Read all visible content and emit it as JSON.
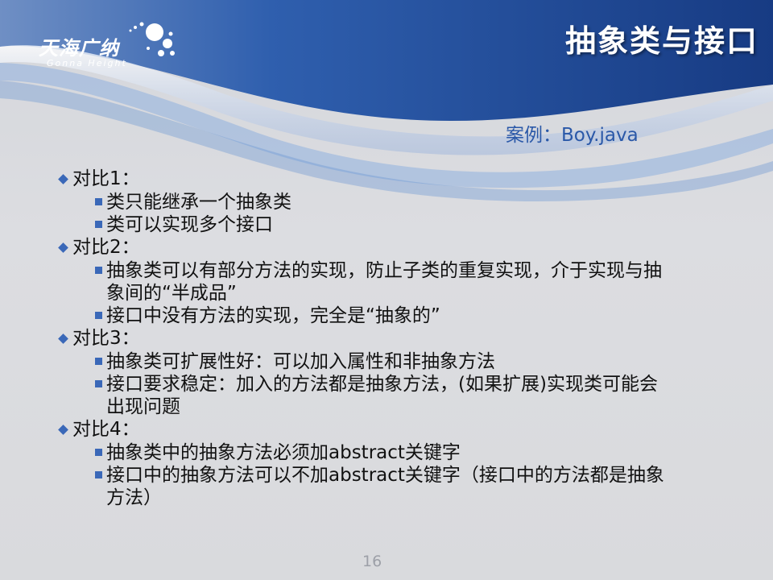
{
  "logo": {
    "name_cn": "天海广纳",
    "name_en": "Gonna Height"
  },
  "title": "抽象类与接口",
  "example": "案例：Boy.java",
  "sections": [
    {
      "heading": "对比1：",
      "items": [
        "类只能继承一个抽象类",
        "类可以实现多个接口"
      ]
    },
    {
      "heading": "对比2：",
      "items": [
        "抽象类可以有部分方法的实现，防止子类的重复实现，介于实现与抽象间的“半成品”",
        "接口中没有方法的实现，完全是“抽象的”"
      ]
    },
    {
      "heading": "对比3：",
      "items": [
        "抽象类可扩展性好：可以加入属性和非抽象方法",
        "接口要求稳定：加入的方法都是抽象方法，(如果扩展)实现类可能会出现问题"
      ]
    },
    {
      "heading": "对比4：",
      "items": [
        "抽象类中的抽象方法必须加abstract关键字",
        "接口中的抽象方法可以不加abstract关键字（接口中的方法都是抽象方法）"
      ]
    }
  ],
  "page_number": "16",
  "colors": {
    "header_dark": "#1b3f86",
    "header_mid": "#2d62b8",
    "accent_text": "#2a58a8",
    "bullet": "#3a68b8"
  }
}
